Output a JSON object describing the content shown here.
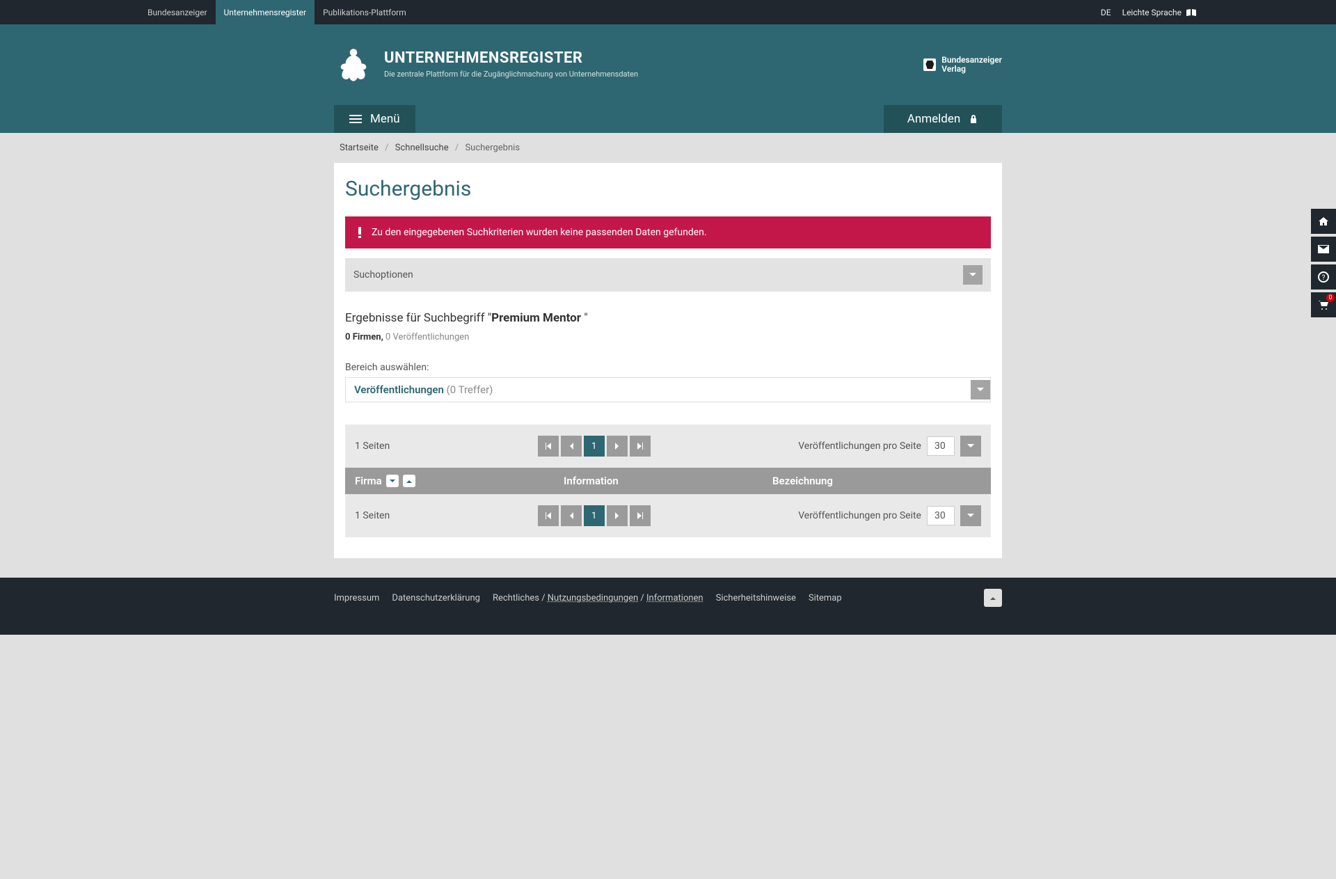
{
  "topbar": {
    "items": [
      "Bundesanzeiger",
      "Unternehmensregister",
      "Publikations-Plattform"
    ],
    "active_index": 1,
    "language": "DE",
    "accessible": "Leichte Sprache"
  },
  "hero": {
    "title": "UNTERNEHMENSREGISTER",
    "subtitle": "Die zentrale Plattform für die Zugänglichmachung\nvon Unternehmensdaten",
    "publisher_line1": "Bundesanzeiger",
    "publisher_line2": "Verlag"
  },
  "menu": {
    "label": "Menü"
  },
  "login": {
    "label": "Anmelden"
  },
  "breadcrumb": {
    "items": [
      "Startseite",
      "Schnellsuche",
      "Suchergebnis"
    ]
  },
  "page": {
    "title": "Suchergebnis"
  },
  "alert": {
    "message": "Zu den eingegebenen Suchkriterien wurden keine passenden Daten gefunden."
  },
  "search_options": {
    "label": "Suchoptionen"
  },
  "results": {
    "prefix": "Ergebnisse für Suchbegriff \"",
    "term": "Premium Mentor",
    "suffix": " \"",
    "firms_count": "0 Firmen,",
    "pubs_count": " 0 Veröffentlichungen"
  },
  "area": {
    "label": "Bereich auswählen:",
    "selected": "Veröffentlichungen",
    "count": " (0 Treffer)"
  },
  "pagination": {
    "page_count": "1 Seiten",
    "current": "1",
    "per_page_label": "Veröffentlichungen pro Seite",
    "per_page_value": "30"
  },
  "table": {
    "columns": [
      "Firma",
      "Information",
      "Bezeichnung"
    ]
  },
  "footer": {
    "impressum": "Impressum",
    "datenschutz": "Datenschutzerklärung",
    "rechtliches_prefix": "Rechtliches / ",
    "nutzung": "Nutzungsbedingungen",
    "informationen": "Informationen",
    "sicherheit": "Sicherheitshinweise",
    "sitemap": "Sitemap"
  },
  "sticky": {
    "cart_badge": "0"
  }
}
